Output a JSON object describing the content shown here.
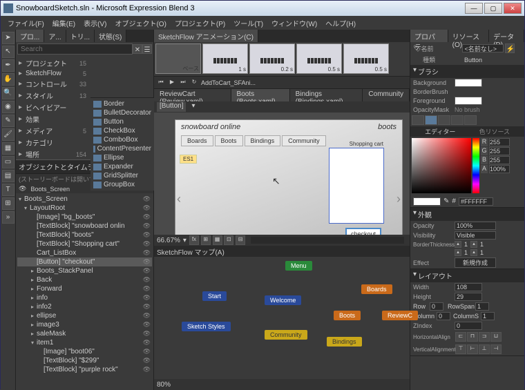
{
  "titlebar": "SnowboardSketch.sln - Microsoft Expression Blend 3",
  "menu": [
    "ファイル(F)",
    "編集(E)",
    "表示(V)",
    "オブジェクト(O)",
    "プロジェクト(P)",
    "ツール(T)",
    "ウィンドウ(W)",
    "ヘルプ(H)"
  ],
  "leftTabs": [
    "プロ...",
    "ア...",
    "トリ...",
    "状態(S)"
  ],
  "anim_tab": "SketchFlow アニメーション(C)",
  "search_placeholder": "Search",
  "projectItems": [
    {
      "name": "プロジェクト",
      "count": "15"
    },
    {
      "name": "SketchFlow",
      "count": "5"
    },
    {
      "name": "コントロール",
      "count": "33"
    },
    {
      "name": "スタイル",
      "count": "13"
    },
    {
      "name": "ビヘイビアー",
      "count": ""
    },
    {
      "name": "効果",
      "count": ""
    },
    {
      "name": "メディア",
      "count": "5"
    },
    {
      "name": "カテゴリ",
      "count": ""
    },
    {
      "name": "場所",
      "count": "154"
    }
  ],
  "assetItems": [
    "Border",
    "BulletDecorator",
    "Button",
    "CheckBox",
    "ComboBox",
    "ContentPresenter",
    "Ellipse",
    "Expander",
    "GridSplitter",
    "GroupBox"
  ],
  "objectsHeader": "オブジェクトとタイムライン(B)",
  "noStoryboard": "(ストーリーボードは開いていません)",
  "treeRoot": "Boots_Screen",
  "tree": [
    {
      "label": "Boots_Screen",
      "lvl": 0,
      "chev": "▾"
    },
    {
      "label": "LayoutRoot",
      "lvl": 1,
      "chev": "▾",
      "sel": false
    },
    {
      "label": "[Image] \"bg_boots\"",
      "lvl": 2
    },
    {
      "label": "[TextBlock] \"snowboard onlin",
      "lvl": 2
    },
    {
      "label": "[TextBlock] \"boots\"",
      "lvl": 2
    },
    {
      "label": "[TextBlock] \"Shopping cart\"",
      "lvl": 2
    },
    {
      "label": "Cart_ListBox",
      "lvl": 2
    },
    {
      "label": "[Button] \"checkout\"",
      "lvl": 2,
      "sel": true
    },
    {
      "label": "Boots_StackPanel",
      "lvl": 2,
      "chev": "▸"
    },
    {
      "label": "Back",
      "lvl": 2,
      "chev": "▸"
    },
    {
      "label": "Forward",
      "lvl": 2,
      "chev": "▸"
    },
    {
      "label": "info",
      "lvl": 2,
      "chev": "▸"
    },
    {
      "label": "info2",
      "lvl": 2,
      "chev": "▸"
    },
    {
      "label": "ellipse",
      "lvl": 2,
      "chev": "▸"
    },
    {
      "label": "image3",
      "lvl": 2,
      "chev": "▸"
    },
    {
      "label": "saleMask",
      "lvl": 2,
      "chev": "▸"
    },
    {
      "label": "item1",
      "lvl": 2,
      "chev": "▾"
    },
    {
      "label": "[Image] \"boot06\"",
      "lvl": 3
    },
    {
      "label": "[TextBlock] \"$299\"",
      "lvl": 3
    },
    {
      "label": "[TextBlock] \"purple rock\"",
      "lvl": 3
    }
  ],
  "frames": [
    {
      "label": "ベース",
      "first": true
    },
    {
      "label": "1 s"
    },
    {
      "label": "0.2 s"
    },
    {
      "label": "0.5 s"
    },
    {
      "label": "0.5 s"
    }
  ],
  "timeline_name": "AddToCart_SFAni...",
  "docTabs": [
    {
      "label": "ReviewCart (Review.xaml)"
    },
    {
      "label": "Boots (Boots.xaml)",
      "active": true
    },
    {
      "label": "Bindings (Bindings.xaml)"
    },
    {
      "label": "Community"
    }
  ],
  "breadcrumb": "[Button]",
  "artboard": {
    "title_left": "snowboard online",
    "title_right": "boots",
    "tabs": [
      "Boards",
      "Boots",
      "Bindings",
      "Community"
    ],
    "cart": "Shopping cart",
    "checkout": "checkout",
    "tag": "ES1"
  },
  "zoom": "66.67%",
  "sketchflowHeader": "SketchFlow マップ(A)",
  "sfNodes": {
    "menu": "Menu",
    "start": "Start",
    "welcome": "Welcome",
    "boards": "Boards",
    "boots": "Boots",
    "review": "ReviewC",
    "styles": "Sketch Styles",
    "community": "Community",
    "bindings": "Bindings"
  },
  "sf_zoom": "80%",
  "rightTabs": [
    "プロパテ...",
    "リソース(O)",
    "データ(D)"
  ],
  "nameLabel": "名前",
  "nameValue": "<名前なし>",
  "typeLabel": "種類",
  "typeValue": "Button",
  "brushHeader": "ブラシ",
  "brushRows": [
    {
      "label": "Background",
      "swatch": "#ffffff"
    },
    {
      "label": "BorderBrush",
      "swatch": ""
    },
    {
      "label": "Foreground",
      "swatch": "#ffffff"
    },
    {
      "label": "OpacityMask",
      "swatch": "No brush"
    }
  ],
  "editorTab": "エディター",
  "resourceTab": "色リソース",
  "rgba": {
    "R": "255",
    "G": "255",
    "B": "255",
    "A": "100%"
  },
  "hex": "#FFFFFF",
  "appearanceHeader": "外観",
  "appearance": {
    "Opacity": "100%",
    "Visibility": "Visible",
    "BorderThickness": "1",
    "Effect": "新規作成"
  },
  "layoutHeader": "レイアウト",
  "layout": {
    "Width": "108",
    "Height": "29",
    "Row": "0",
    "RowSpan": "1",
    "Column": "0",
    "ColumnS": "1",
    "ZIndex": "0",
    "HAlign": "HorizontalAlign",
    "VAlign": "VerticalAlignment"
  }
}
